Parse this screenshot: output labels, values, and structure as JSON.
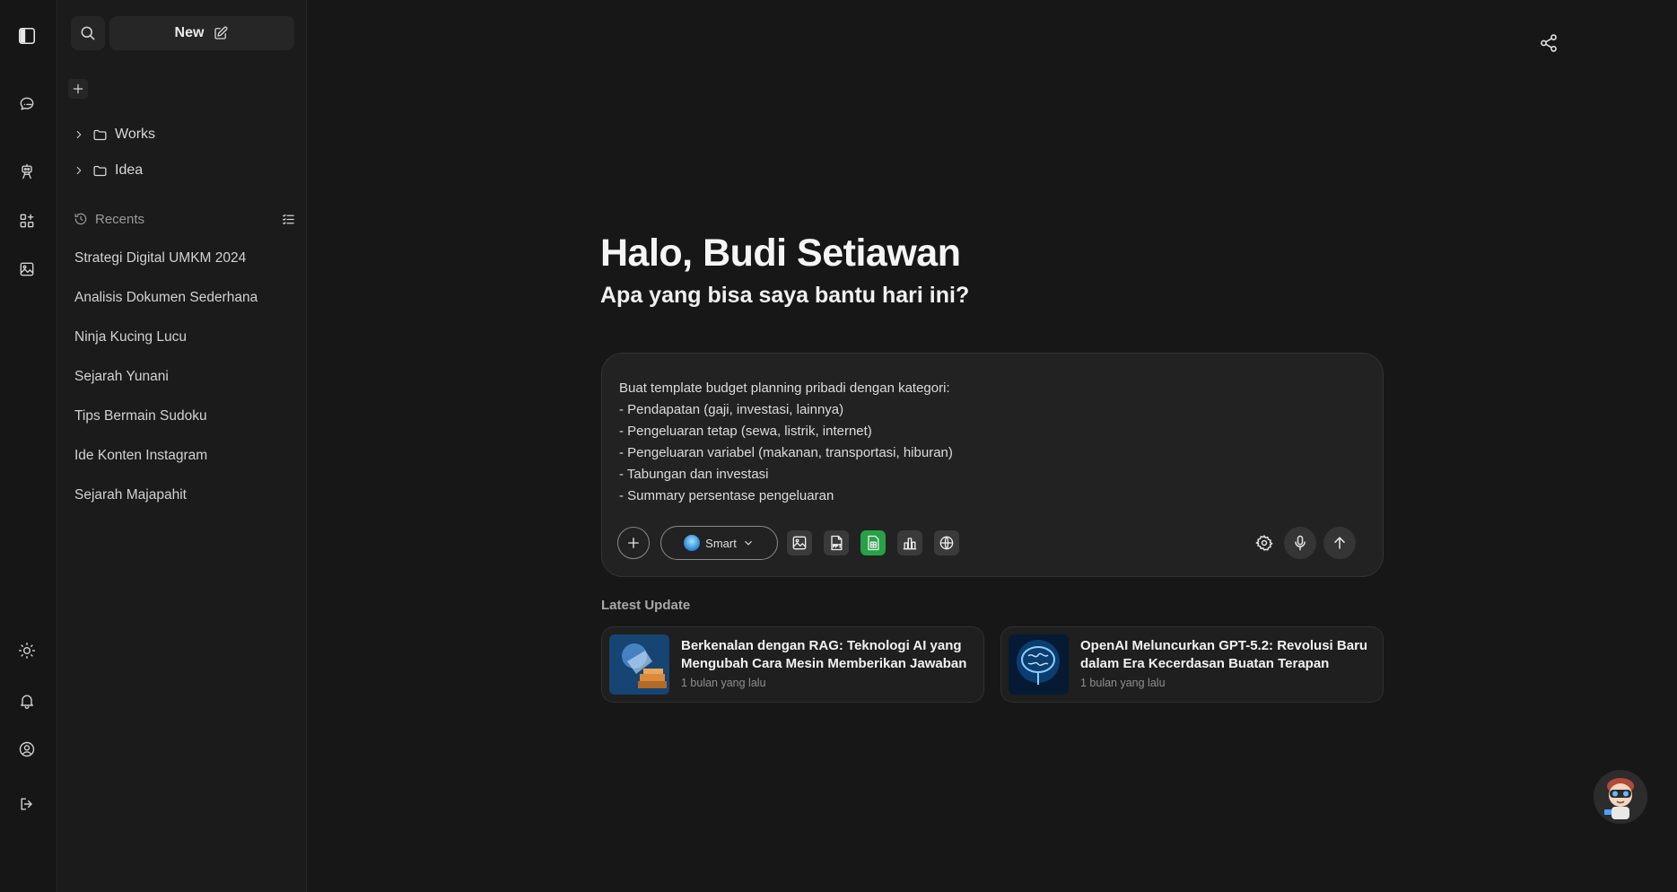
{
  "rail": {
    "icons": [
      "sidebar-toggle-icon",
      "chat-icon",
      "robot-icon",
      "apps-icon",
      "image-icon",
      "sun-icon",
      "bell-icon",
      "user-icon",
      "logout-icon"
    ]
  },
  "sidebar": {
    "new_label": "New",
    "folders": [
      {
        "label": "Works"
      },
      {
        "label": "Idea"
      }
    ],
    "recents_label": "Recents",
    "recents": [
      "Strategi Digital UMKM 2024",
      "Analisis Dokumen Sederhana",
      "Ninja Kucing Lucu",
      "Sejarah Yunani",
      "Tips Bermain Sudoku",
      "Ide Konten Instagram",
      "Sejarah Majapahit"
    ]
  },
  "main": {
    "greeting": "Halo, Budi Setiawan",
    "subtitle": "Apa yang bisa saya bantu hari ini?",
    "prompt_text": "Buat template budget planning pribadi dengan kategori:\n- Pendapatan (gaji, investasi, lainnya)\n- Pengeluaran tetap (sewa, listrik, internet)\n- Pengeluaran variabel (makanan, transportasi, hiburan)\n- Tabungan dan investasi\n- Summary persentase pengeluaran",
    "model_label": "Smart",
    "latest_label": "Latest Update",
    "cards": [
      {
        "title": "Berkenalan dengan RAG: Teknologi AI yang Mengubah Cara Mesin Memberikan Jawaban",
        "time": "1 bulan yang lalu"
      },
      {
        "title": "OpenAI Meluncurkan GPT-5.2: Revolusi Baru dalam Era Kecerdasan Buatan Terapan",
        "time": "1 bulan yang lalu"
      }
    ]
  },
  "colors": {
    "background": "#171717",
    "sidebar": "#1b1b1b",
    "composer": "#222222",
    "sheet_green": "#27a145"
  }
}
